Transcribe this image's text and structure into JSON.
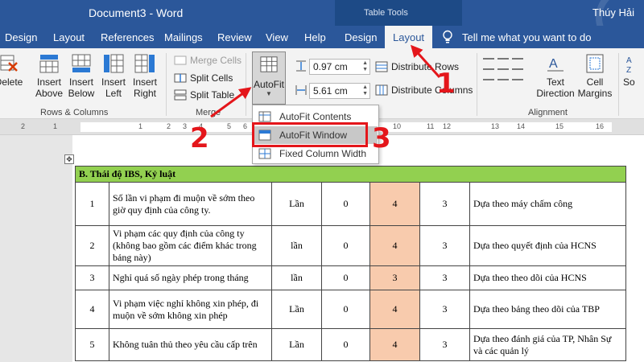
{
  "app": {
    "doc_title": "Document3 - Word",
    "table_tools": "Table Tools",
    "user_name": "Thúy Hải"
  },
  "tabs": {
    "design": "Design",
    "layout": "Layout",
    "references": "References",
    "mailings": "Mailings",
    "review": "Review",
    "view": "View",
    "help": "Help",
    "table_design": "Design",
    "table_layout": "Layout",
    "tell_me": "Tell me what you want to do"
  },
  "ribbon": {
    "delete": "Delete",
    "insert_above": [
      "Insert",
      "Above"
    ],
    "insert_below": [
      "Insert",
      "Below"
    ],
    "insert_left": [
      "Insert",
      "Left"
    ],
    "insert_right": [
      "Insert",
      "Right"
    ],
    "rows_columns": "Rows & Columns",
    "merge_cells": "Merge Cells",
    "split_cells": "Split Cells",
    "split_table": "Split Table",
    "merge_group": "Merge",
    "autofit": "AutoFit",
    "row_height": "0.97 cm",
    "col_width": "5.61 cm",
    "distribute_rows": "Distribute Rows",
    "distribute_columns": "Distribute Columns",
    "text_direction": [
      "Text",
      "Direction"
    ],
    "cell_margins": [
      "Cell",
      "Margins"
    ],
    "alignment": "Alignment",
    "sort_partial": "So"
  },
  "ruler_marks": [
    "2",
    "1",
    "1",
    "2",
    "3",
    "4",
    "5",
    "6",
    "7",
    "8",
    "9",
    "10",
    "11",
    "12",
    "13",
    "14",
    "15",
    "16"
  ],
  "dropdown": {
    "items": [
      "AutoFit Contents",
      "AutoFit Window",
      "Fixed Column Width"
    ]
  },
  "annotations": [
    "1",
    "2",
    "3"
  ],
  "colors": {
    "word_blue": "#2b579a",
    "header_green": "#92d050",
    "highlight_peach": "#f8cbad",
    "annotation_red": "#e4161b"
  },
  "table": {
    "header": "B. Thái độ IBS, Kỷ luật",
    "rows": [
      {
        "no": "1",
        "desc": "Số lần vi phạm đi muộn về sớm theo giờ quy định của công ty.",
        "unit": "Lần",
        "a": "0",
        "b": "4",
        "c": "3",
        "note": "Dựa theo máy chấm công"
      },
      {
        "no": "2",
        "desc": "Vi phạm các quy định của công ty (không bao gồm các điểm khác trong bảng này)",
        "unit": "lần",
        "a": "0",
        "b": "4",
        "c": "3",
        "note": "Dựa theo quyết định của HCNS"
      },
      {
        "no": "3",
        "desc": "Nghỉ quá số ngày phép trong tháng",
        "unit": "lần",
        "a": "0",
        "b": "3",
        "c": "3",
        "note": "Dựa theo theo dõi của HCNS"
      },
      {
        "no": "4",
        "desc": "Vi phạm việc nghỉ không xin phép, đi muộn về sớm không xin phép",
        "unit": "Lần",
        "a": "0",
        "b": "4",
        "c": "3",
        "note": "Dựa theo bảng theo dõi của TBP"
      },
      {
        "no": "5",
        "desc": "Không tuân thủ theo yêu cầu cấp trên",
        "unit": "Lần",
        "a": "0",
        "b": "4",
        "c": "3",
        "note": "Dựa theo đánh giá của TP, Nhân Sự và các quản lý"
      }
    ]
  }
}
